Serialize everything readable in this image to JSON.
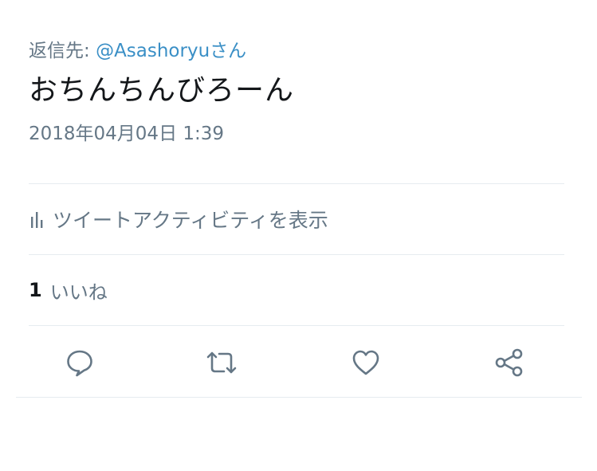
{
  "tweet": {
    "reply_prefix": "返信先: ",
    "reply_handle": "@Asashoryuさん",
    "text": "おちんちんびろーん",
    "timestamp": "2018年04月04日 1:39"
  },
  "activity": {
    "label": "ツイートアクティビティを表示",
    "icon": "bar-chart-icon"
  },
  "likes": {
    "count": "1",
    "label": "いいね"
  },
  "actions": {
    "icons": [
      "reply-icon",
      "retweet-icon",
      "like-icon",
      "share-icon"
    ]
  },
  "colors": {
    "text": "#14171a",
    "secondary": "#657786",
    "link": "#3a8fc6",
    "icon": "#657786",
    "divider": "#e6ecf0"
  }
}
